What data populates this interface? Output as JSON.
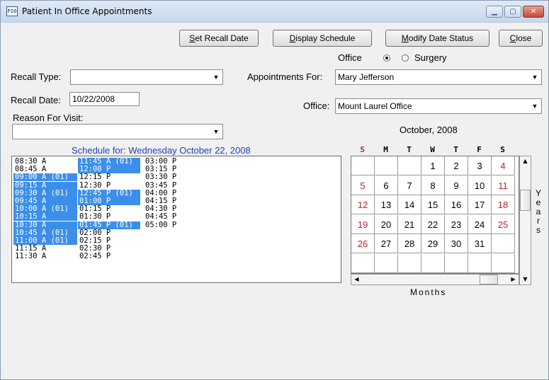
{
  "window": {
    "title": "Patient In Office Appointments",
    "icon_text": "PIO"
  },
  "buttons": {
    "set_recall_prefix": "S",
    "set_recall_rest": "et Recall Date",
    "display_prefix": "D",
    "display_rest": "isplay Schedule",
    "modify_prefix": "M",
    "modify_rest": "odify Date Status",
    "close_prefix": "C",
    "close_rest": "lose"
  },
  "office_toggle": {
    "office_label": "Office",
    "surgery_label": "Surgery",
    "selected": "office"
  },
  "recall_type": {
    "label": "Recall Type:",
    "value": ""
  },
  "recall_date": {
    "label": "Recall Date:",
    "value": "10/22/2008"
  },
  "reason": {
    "label": "Reason For Visit:",
    "value": ""
  },
  "appointments_for": {
    "label": "Appointments For:",
    "value": "Mary Jefferson"
  },
  "office": {
    "label": "Office:",
    "value": "Mount Laurel Office"
  },
  "schedule": {
    "header": "Schedule for:  Wednesday October 22, 2008",
    "columns": [
      [
        {
          "t": "08:30 A",
          "b": false
        },
        {
          "t": "08:45 A",
          "b": false
        },
        {
          "t": "09:00 A (01)",
          "b": true
        },
        {
          "t": "09:15 A",
          "b": true
        },
        {
          "t": "09:30 A (01)",
          "b": true
        },
        {
          "t": "09:45 A",
          "b": true
        },
        {
          "t": "10:00 A (01)",
          "b": true
        },
        {
          "t": "10:15 A",
          "b": true
        },
        {
          "t": "10:30 A",
          "b": true
        },
        {
          "t": "10:45 A (01)",
          "b": true
        },
        {
          "t": "11:00 A (01)",
          "b": true
        },
        {
          "t": "11:15 A",
          "b": false
        },
        {
          "t": "11:30 A",
          "b": false
        }
      ],
      [
        {
          "t": "11:45 A (01)",
          "b": true
        },
        {
          "t": "12:00 P",
          "b": true
        },
        {
          "t": "12:15 P",
          "b": false
        },
        {
          "t": "12:30 P",
          "b": false
        },
        {
          "t": "12:45 P (01)",
          "b": true
        },
        {
          "t": "01:00 P",
          "b": true
        },
        {
          "t": "01:15 P",
          "b": false
        },
        {
          "t": "01:30 P",
          "b": false
        },
        {
          "t": "01:45 P (01)",
          "b": true
        },
        {
          "t": "02:00 P",
          "b": false
        },
        {
          "t": "02:15 P",
          "b": false
        },
        {
          "t": "02:30 P",
          "b": false
        },
        {
          "t": "02:45 P",
          "b": false
        }
      ],
      [
        {
          "t": "03:00 P",
          "b": false
        },
        {
          "t": "03:15 P",
          "b": false
        },
        {
          "t": "03:30 P",
          "b": false
        },
        {
          "t": "03:45 P",
          "b": false
        },
        {
          "t": "04:00 P",
          "b": false
        },
        {
          "t": "04:15 P",
          "b": false
        },
        {
          "t": "04:30 P",
          "b": false
        },
        {
          "t": "04:45 P",
          "b": false
        },
        {
          "t": "05:00 P",
          "b": false
        }
      ]
    ]
  },
  "calendar": {
    "title": "October, 2008",
    "days_of_week": [
      "S",
      "M",
      "T",
      "W",
      "T",
      "F",
      "S"
    ],
    "weeks": [
      [
        "",
        "",
        "",
        "1",
        "2",
        "3",
        "4"
      ],
      [
        "5",
        "6",
        "7",
        "8",
        "9",
        "10",
        "11"
      ],
      [
        "12",
        "13",
        "14",
        "15",
        "16",
        "17",
        "18"
      ],
      [
        "19",
        "20",
        "21",
        "22",
        "23",
        "24",
        "25"
      ],
      [
        "26",
        "27",
        "28",
        "29",
        "30",
        "31",
        ""
      ],
      [
        "",
        "",
        "",
        "",
        "",
        "",
        ""
      ]
    ],
    "weekend_color": "#c0222a",
    "years_label": "Years",
    "months_label": "Months"
  },
  "colors": {
    "booked_slot": "#3b8fea",
    "schedule_header": "#1f3fbf"
  }
}
